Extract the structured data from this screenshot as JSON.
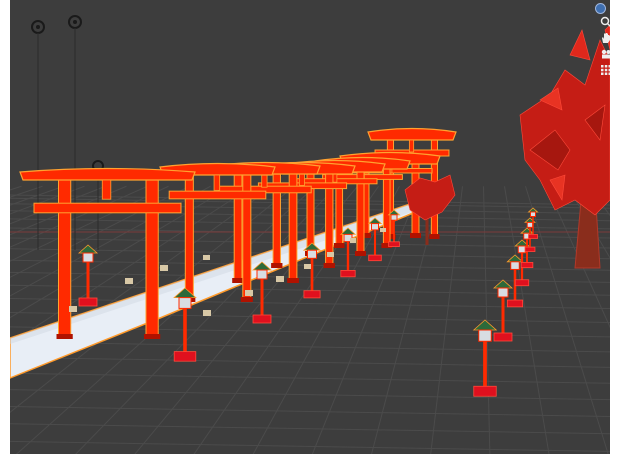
{
  "app": {
    "view": "3D Viewport"
  },
  "colors": {
    "background": "#3d3d3d",
    "grid": "#4a4a4a",
    "torii": "#ff2a00",
    "outline": "#ffa230",
    "path": "#e8eef6",
    "lantern_base": "#e0101e",
    "tree": "#c71e18"
  },
  "navigation_gizmo": {
    "axis_widget": "view-axis-dot",
    "tools": [
      {
        "name": "zoom",
        "icon": "magnifier-icon"
      },
      {
        "name": "pan",
        "icon": "hand-icon"
      },
      {
        "name": "camera",
        "icon": "camera-icon"
      },
      {
        "name": "toggle-ortho",
        "icon": "grid-icon"
      }
    ]
  },
  "scene": {
    "objects": [
      "torii-gates",
      "stone-path",
      "lanterns-left",
      "lanterns-right",
      "maple-tree",
      "small-maple",
      "lights"
    ]
  }
}
